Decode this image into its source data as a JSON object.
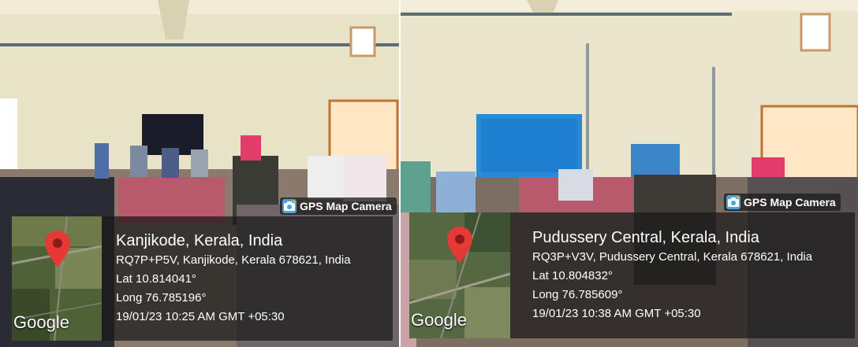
{
  "photos": [
    {
      "badge_label": "GPS Map Camera",
      "place": "Kanjikode, Kerala, India",
      "address": "RQ7P+P5V, Kanjikode, Kerala 678621, India",
      "lat": "Lat 10.814041°",
      "long": "Long 76.785196°",
      "datetime": "19/01/23 10:25 AM GMT +05:30",
      "map_brand": "Google"
    },
    {
      "badge_label": "GPS Map Camera",
      "place": "Pudussery Central, Kerala, India",
      "address": "RQ3P+V3V, Pudussery Central, Kerala 678621, India",
      "lat": "Lat 10.804832°",
      "long": "Long 76.785609°",
      "datetime": "19/01/23 10:38 AM GMT +05:30",
      "map_brand": "Google"
    }
  ],
  "icons": {
    "badge": "gps-camera-icon",
    "pin": "map-pin-icon"
  },
  "colors": {
    "pin": "#e53935",
    "overlay": "#191919",
    "wall": "#e9e3c9"
  }
}
